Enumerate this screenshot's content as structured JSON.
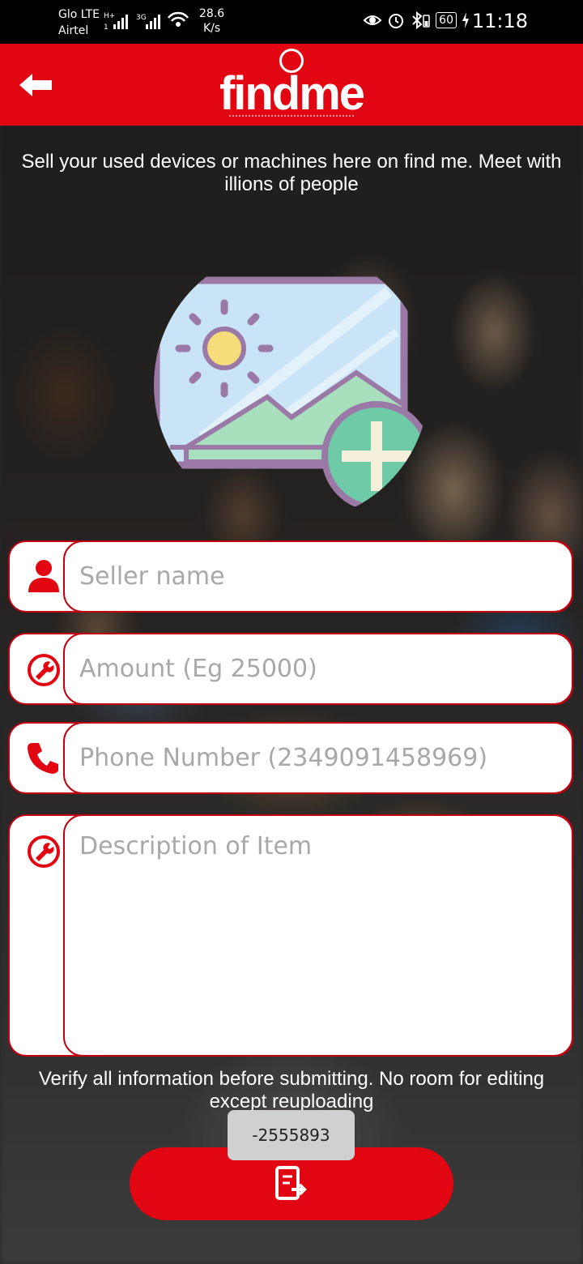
{
  "status_bar": {
    "carrier_1": "Glo LTE",
    "carrier_2": "Airtel",
    "network_1": "H+",
    "network_2": "3G",
    "data_sub": "1",
    "speed_value": "28.6",
    "speed_unit": "K/s",
    "battery": "60",
    "time": "11:18",
    "icons": [
      "eye-icon",
      "alarm-icon",
      "bluetooth-icon",
      "battery-icon",
      "charging-icon"
    ]
  },
  "app_bar": {
    "logo_text": "findme",
    "back_icon": "arrow-left-icon",
    "color": "#e20613"
  },
  "intro_text": "Sell your used devices or machines here on find me. Meet with illions of people",
  "upload": {
    "icon": "add-image-icon"
  },
  "form": {
    "seller_name": {
      "placeholder": "Seller name",
      "value": "",
      "icon": "person-icon"
    },
    "amount": {
      "placeholder": "Amount (Eg 25000)",
      "value": "",
      "icon": "wrench-icon"
    },
    "phone": {
      "placeholder": "Phone Number (2349091458969)",
      "value": "",
      "icon": "phone-icon"
    },
    "description": {
      "placeholder": "Description of Item",
      "value": "",
      "icon": "wrench-icon"
    }
  },
  "notice_text": "Verify all information before submitting. No room for editing except reuploading",
  "toast_text": "-2555893",
  "submit": {
    "icon": "submit-upload-icon"
  },
  "colors": {
    "primary": "#e20613",
    "border": "#c40010"
  }
}
